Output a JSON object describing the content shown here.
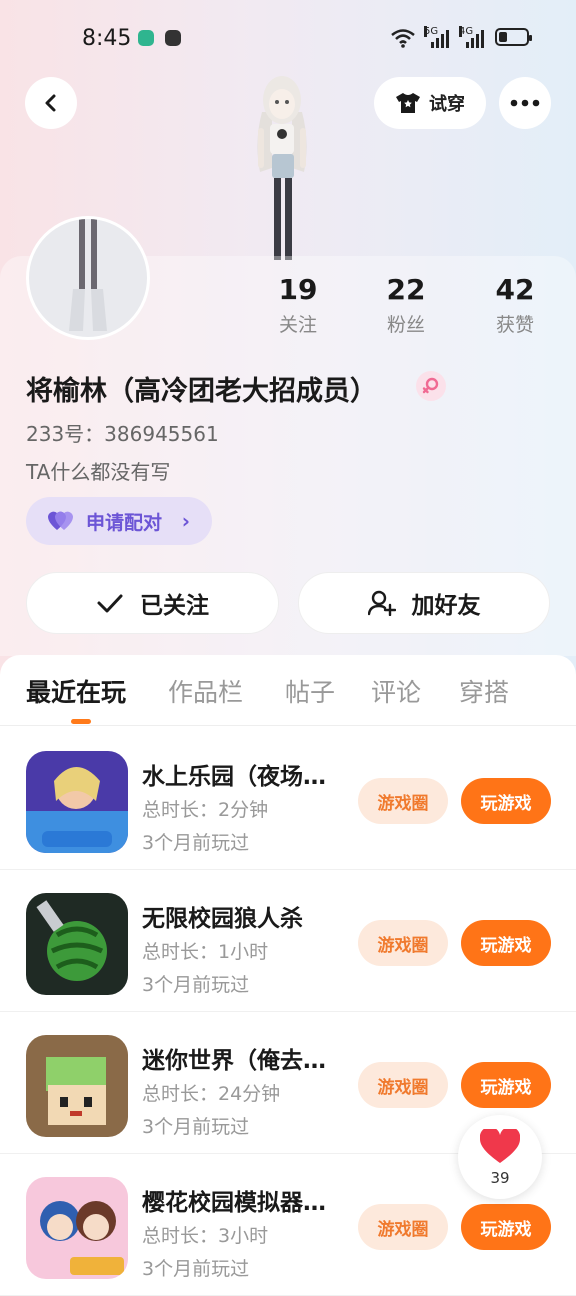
{
  "status": {
    "time": "8:45",
    "net1": "5G",
    "net2": "4G"
  },
  "header": {
    "tryon_label": "试穿"
  },
  "stats": [
    {
      "num": "19",
      "label": "关注"
    },
    {
      "num": "22",
      "label": "粉丝"
    },
    {
      "num": "42",
      "label": "获赞"
    }
  ],
  "profile": {
    "nickname": "将榆林（高冷团老大招成员）",
    "uid": "233号：386945561",
    "bio": "TA什么都没有写",
    "pair_label": "申请配对"
  },
  "actions": {
    "follow_label": "已关注",
    "friend_label": "加好友"
  },
  "tabs": [
    "最近在玩",
    "作品栏",
    "帖子",
    "评论",
    "穿搭"
  ],
  "games": [
    {
      "title": "水上乐园（夜场…",
      "duration": "总时长：2分钟",
      "last": "3个月前玩过",
      "circle": "游戏圈",
      "play": "玩游戏"
    },
    {
      "title": "无限校园狼人杀",
      "duration": "总时长：1小时",
      "last": "3个月前玩过",
      "circle": "游戏圈",
      "play": "玩游戏"
    },
    {
      "title": "迷你世界（俺去…",
      "duration": "总时长：24分钟",
      "last": "3个月前玩过",
      "circle": "游戏圈",
      "play": "玩游戏"
    },
    {
      "title": "樱花校园模拟器…",
      "duration": "总时长：3小时",
      "last": "3个月前玩过",
      "circle": "游戏圈",
      "play": "玩游戏"
    }
  ],
  "like": {
    "count": "39"
  },
  "colors": {
    "accent": "#ff7417",
    "pair": "#6c55d6"
  }
}
